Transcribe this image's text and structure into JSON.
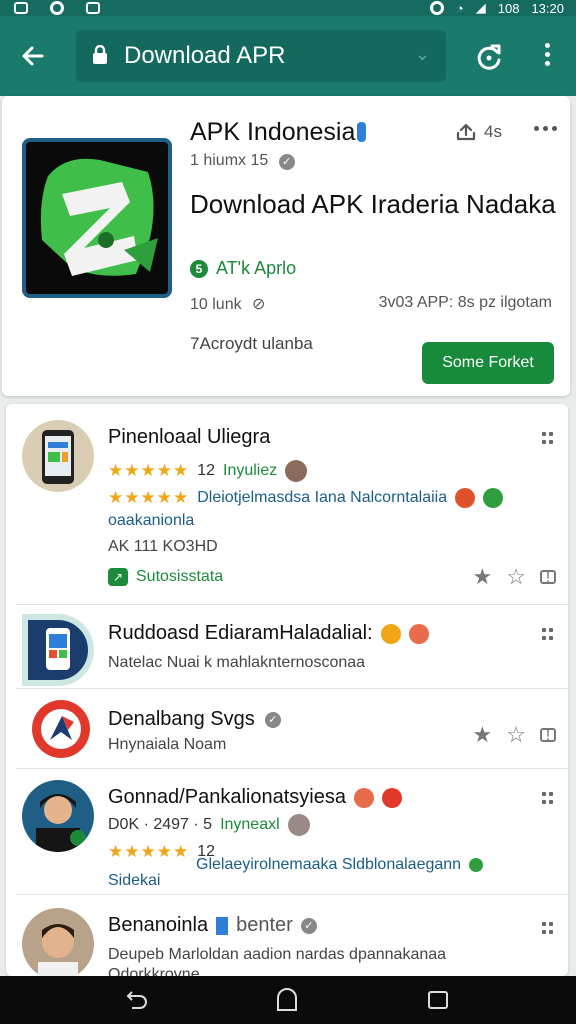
{
  "status_bar": {
    "time": "13:20",
    "battery": "108"
  },
  "toolbar": {
    "url_text": "Download APR",
    "back_icon": "arrow-left-icon",
    "lock_icon": "lock-icon",
    "refresh_icon": "refresh-icon",
    "menu_icon": "vertical-ellipsis-icon"
  },
  "app_card": {
    "title": "APK Indonesia",
    "share_count": "4s",
    "subtitle": "1 hiumx 15",
    "headline": "Download APK Iraderia Nadaka",
    "developer": "AT'k Aprlo",
    "meta_left": "10 lunk",
    "meta_right": "3v03 APP: 8s pz ilgotam",
    "description": "7Acroydt ulanba",
    "cta_label": "Some Forket"
  },
  "list": {
    "items": [
      {
        "title": "Pinenloaal Uliegra",
        "rating_count": "12",
        "rating_label": "Inyuliez",
        "line2": "Dleiotjelmasdsa Iana Nalcorntalaiia",
        "line3": "oaakanionla",
        "meta": "AK 111 KO3HD",
        "status": "Sutosisstata"
      },
      {
        "title": "Ruddoasd EdiaramHaladalial:",
        "line2": "Natelac Nuai k mahlaknternosconaa"
      },
      {
        "title": "Denalbang Svgs",
        "line2": "Hnynaiala Noam"
      },
      {
        "title": "Gonnad/Pankalionatsyiesa",
        "line2_left": "D0K · 2497 · 5",
        "line2_label": "Inyneaxl",
        "rating_count": "12",
        "line3": "Glelaeyirolnemaaka Sldblonalaegann",
        "line4": "Sidekai"
      },
      {
        "title": "Benanoinla",
        "title_tag": "benter",
        "line2": "Deupeb Marloldan aadion nardas dpannakanaa",
        "line3": "Odorkkrovne"
      }
    ]
  },
  "colors": {
    "toolbar": "#1a7a6c",
    "status_bar": "#156b5f",
    "accent_green": "#178a3b",
    "star": "#f2a516"
  }
}
